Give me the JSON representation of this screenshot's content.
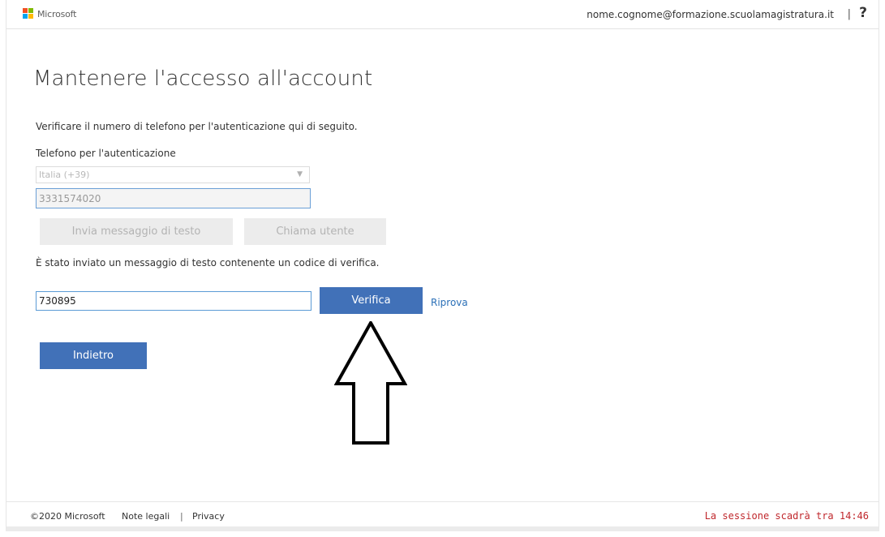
{
  "header": {
    "logo_text": "Microsoft",
    "logo_colors": [
      "#f25022",
      "#7fba00",
      "#00a4ef",
      "#ffb900"
    ],
    "account_email": "nome.cognome@formazione.scuolamagistratura.it",
    "separator": "|",
    "help_label": "?"
  },
  "main": {
    "title": "Mantenere l'accesso all'account",
    "description": "Verificare il numero di telefono per l'autenticazione qui di seguito.",
    "phone_label": "Telefono per l'autenticazione",
    "country_selected": "Italia (+39)",
    "phone_value": "3331574020",
    "sms_button": "Invia messaggio di testo",
    "call_button": "Chiama utente",
    "sent_message": "È stato inviato un messaggio di testo contenente un codice di verifica.",
    "code_value": "730895",
    "verify_button": "Verifica",
    "retry_link": "Riprova",
    "back_button": "Indietro"
  },
  "footer": {
    "copyright": "©2020 Microsoft",
    "legal_link": "Note legali",
    "separator": "|",
    "privacy_link": "Privacy",
    "session_text": "La sessione scadrà tra 14:46"
  },
  "colors": {
    "primary_button": "#4171b8",
    "link": "#2a6fb7",
    "session_warning": "#c0282d"
  },
  "annotation": {
    "icon": "up-arrow-icon"
  }
}
